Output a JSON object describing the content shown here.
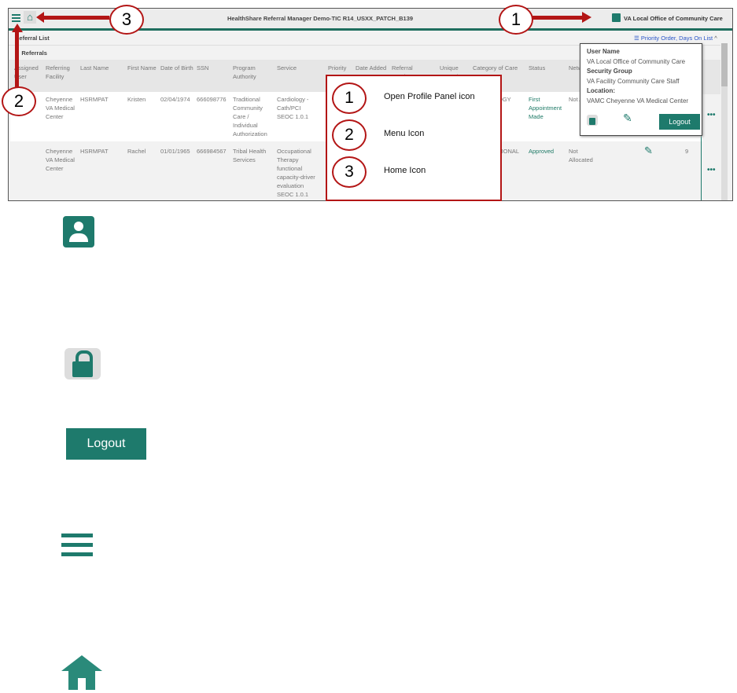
{
  "app": {
    "title": "HealthShare Referral Manager Demo-TIC R14_USXX_PATCH_B139",
    "profile_label": "VA Local Office of Community Care",
    "breadcrumb": "Referral List",
    "sort_label": "Priority Order, Days On List",
    "section": "Referrals"
  },
  "table": {
    "headers": [
      "Assigned User",
      "Referring Facility",
      "Last Name",
      "First Name",
      "Date of Birth",
      "SSN",
      "Program Authority",
      "Service",
      "Priority",
      "Date Added",
      "Referral Number",
      "Unique Consult",
      "Category of Care",
      "Status",
      "Network"
    ],
    "rows": [
      {
        "facility": "Cheyenne VA Medical Center",
        "last": "HSRMPAT",
        "first": "Kristen",
        "dob": "02/04/1974",
        "ssn": "666098776",
        "authority": "Traditional Community Care / Individual Authorization",
        "service": "Cardiology - Cath/PCI SEOC 1.0.1",
        "category": "OGY",
        "status": "First Appointment Made",
        "network": "Not Allo"
      },
      {
        "facility": "Cheyenne VA Medical Center",
        "last": "HSRMPAT",
        "first": "Rachel",
        "dob": "01/01/1965",
        "ssn": "666984567",
        "authority": "Tribal Health Services",
        "service": "Occupational Therapy functional capacity-driver evaluation SEOC 1.0.1",
        "category": "TIONAL",
        "status": "Approved",
        "network": "Not Allocated",
        "count": "9"
      }
    ]
  },
  "profile_panel": {
    "user_name_label": "User Name",
    "user_name": "VA Local Office of Community Care",
    "security_group_label": "Security Group",
    "security_group": "VA Facility Community Care Staff",
    "location_label": "Location:",
    "location": "VAMC Cheyenne VA Medical Center",
    "logout": "Logout"
  },
  "annotations": {
    "n1": "1",
    "n2": "2",
    "n3": "3"
  },
  "legend": [
    {
      "num": "1",
      "label": "Open Profile Panel icon"
    },
    {
      "num": "2",
      "label": "Menu Icon"
    },
    {
      "num": "3",
      "label": "Home Icon"
    }
  ],
  "icons_below": {
    "logout_label": "Logout"
  },
  "colors": {
    "teal": "#1e7a6c",
    "annotation_red": "#b31515"
  }
}
